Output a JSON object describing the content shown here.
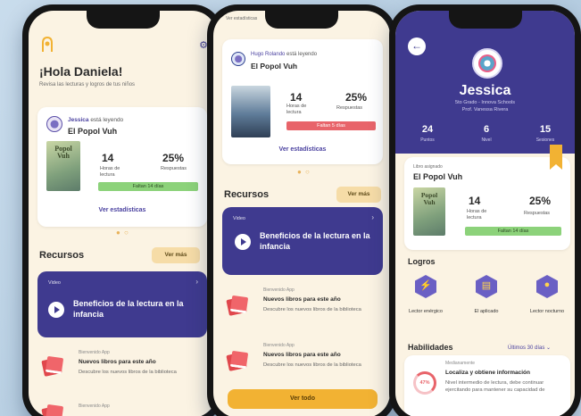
{
  "colors": {
    "brand_purple": "#3f3a8f",
    "accent_gold": "#f2b233",
    "cream_bg": "#fbf3e3",
    "success_green": "#8cd27a",
    "alert_red": "#e8646a"
  },
  "phone1": {
    "greeting": "¡Hola Daniela!",
    "subtitle": "Revisa las lecturas y logros de tus niños",
    "reading_card": {
      "reader_name": "Jessica",
      "reader_action": "está leyendo",
      "book_title": "El Popol Vuh",
      "cover_text_1": "Popol",
      "cover_text_2": "Vuh",
      "hours_value": "14",
      "hours_label": "Horas de lectura",
      "answers_value": "25%",
      "answers_label": "Respuestas",
      "status": "Faltan 14 días",
      "link": "Ver estadísticas"
    },
    "resources_title": "Recursos",
    "see_more": "Ver más",
    "promo": {
      "tag": "Video",
      "title": "Beneficios de la lectura en la infancia"
    },
    "resource_items": [
      {
        "tag": "Bienvenido App",
        "title": "Nuevos libros para este año",
        "desc": "Descubre los nuevos libros de la biblioteca"
      },
      {
        "tag": "Bienvenido App"
      }
    ]
  },
  "phone2": {
    "header_partial": "Ver estadísticas",
    "reading_card": {
      "reader_name": "Hugo Rolando",
      "reader_action": "está leyendo",
      "book_title": "El Popol Vuh",
      "hours_value": "14",
      "hours_label": "Horas de lectura",
      "answers_value": "25%",
      "answers_label": "Respuestas",
      "status": "Faltan 5 días",
      "link": "Ver estadísticas"
    },
    "resources_title": "Recursos",
    "see_more": "Ver más",
    "promo": {
      "tag": "Video",
      "title": "Beneficios de la lectura en la infancia"
    },
    "resource_items": [
      {
        "tag": "Bienvenido App",
        "title": "Nuevos libros para este año",
        "desc": "Descubre los nuevos libros de la biblioteca"
      },
      {
        "tag": "Bienvenido App",
        "title": "Nuevos libros para este año",
        "desc": "Descubre los nuevos libros de la biblioteca"
      }
    ],
    "cta": "Ver todo"
  },
  "phone3": {
    "name": "Jessica",
    "grade_line": "5to Grado - Innova Schools",
    "teacher_line": "Prof. Vanessa Rivera",
    "stats": [
      {
        "value": "24",
        "label": "Puntos"
      },
      {
        "value": "6",
        "label": "Nivel"
      },
      {
        "value": "15",
        "label": "Sesiones"
      }
    ],
    "book_card": {
      "kicker": "Libro asignado",
      "book_title": "El Popol Vuh",
      "cover_text_1": "Popol",
      "cover_text_2": "Vuh",
      "hours_value": "14",
      "hours_label": "Horas de lectura",
      "answers_value": "25%",
      "answers_label": "Respuestas",
      "status": "Faltan 14 días"
    },
    "achievements_title": "Logros",
    "achievements": [
      {
        "icon": "lightning-icon",
        "label": "Lector enérgico"
      },
      {
        "icon": "books-icon",
        "label": "El aplicado"
      },
      {
        "icon": "owl-icon",
        "label": "Lector nocturno"
      }
    ],
    "skills_title": "Habilidades",
    "skills_filter": "Últimos 30 días",
    "skill": {
      "percent": "47%",
      "tag": "Medianamente",
      "title": "Localiza y obtiene información",
      "desc": "Nivel intermedio de lectura, debe continuar ejercitando para mantener su capacidad de"
    }
  }
}
